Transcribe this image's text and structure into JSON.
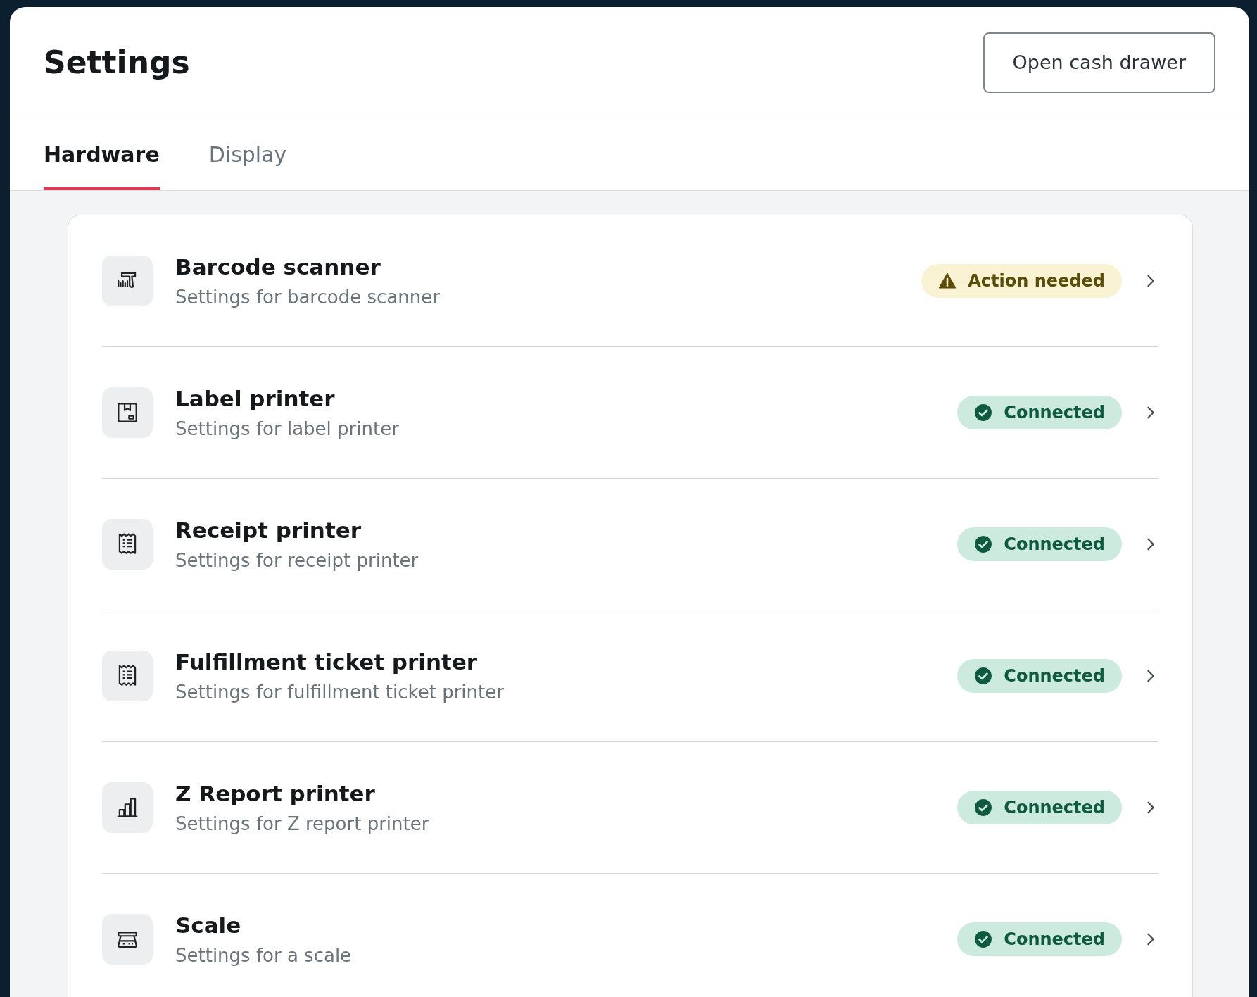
{
  "header": {
    "title": "Settings",
    "button": "Open cash drawer"
  },
  "tabs": [
    {
      "label": "Hardware",
      "selected": true
    },
    {
      "label": "Display",
      "selected": false
    }
  ],
  "devices": [
    {
      "kind": "scanner",
      "title": "Barcode scanner",
      "subtitle": "Settings for barcode scanner",
      "status": {
        "kind": "warning",
        "label": "Action needed"
      }
    },
    {
      "kind": "box",
      "title": "Label printer",
      "subtitle": "Settings for label printer",
      "status": {
        "kind": "ok",
        "label": "Connected"
      }
    },
    {
      "kind": "receipt",
      "title": "Receipt printer",
      "subtitle": "Settings for receipt printer",
      "status": {
        "kind": "ok",
        "label": "Connected"
      }
    },
    {
      "kind": "receipt",
      "title": "Fulfillment ticket printer",
      "subtitle": "Settings for fulfillment ticket printer",
      "status": {
        "kind": "ok",
        "label": "Connected"
      }
    },
    {
      "kind": "chart",
      "title": "Z Report printer",
      "subtitle": "Settings for Z report printer",
      "status": {
        "kind": "ok",
        "label": "Connected"
      }
    },
    {
      "kind": "scale",
      "title": "Scale",
      "subtitle": "Settings for a scale",
      "status": {
        "kind": "ok",
        "label": "Connected"
      }
    }
  ]
}
